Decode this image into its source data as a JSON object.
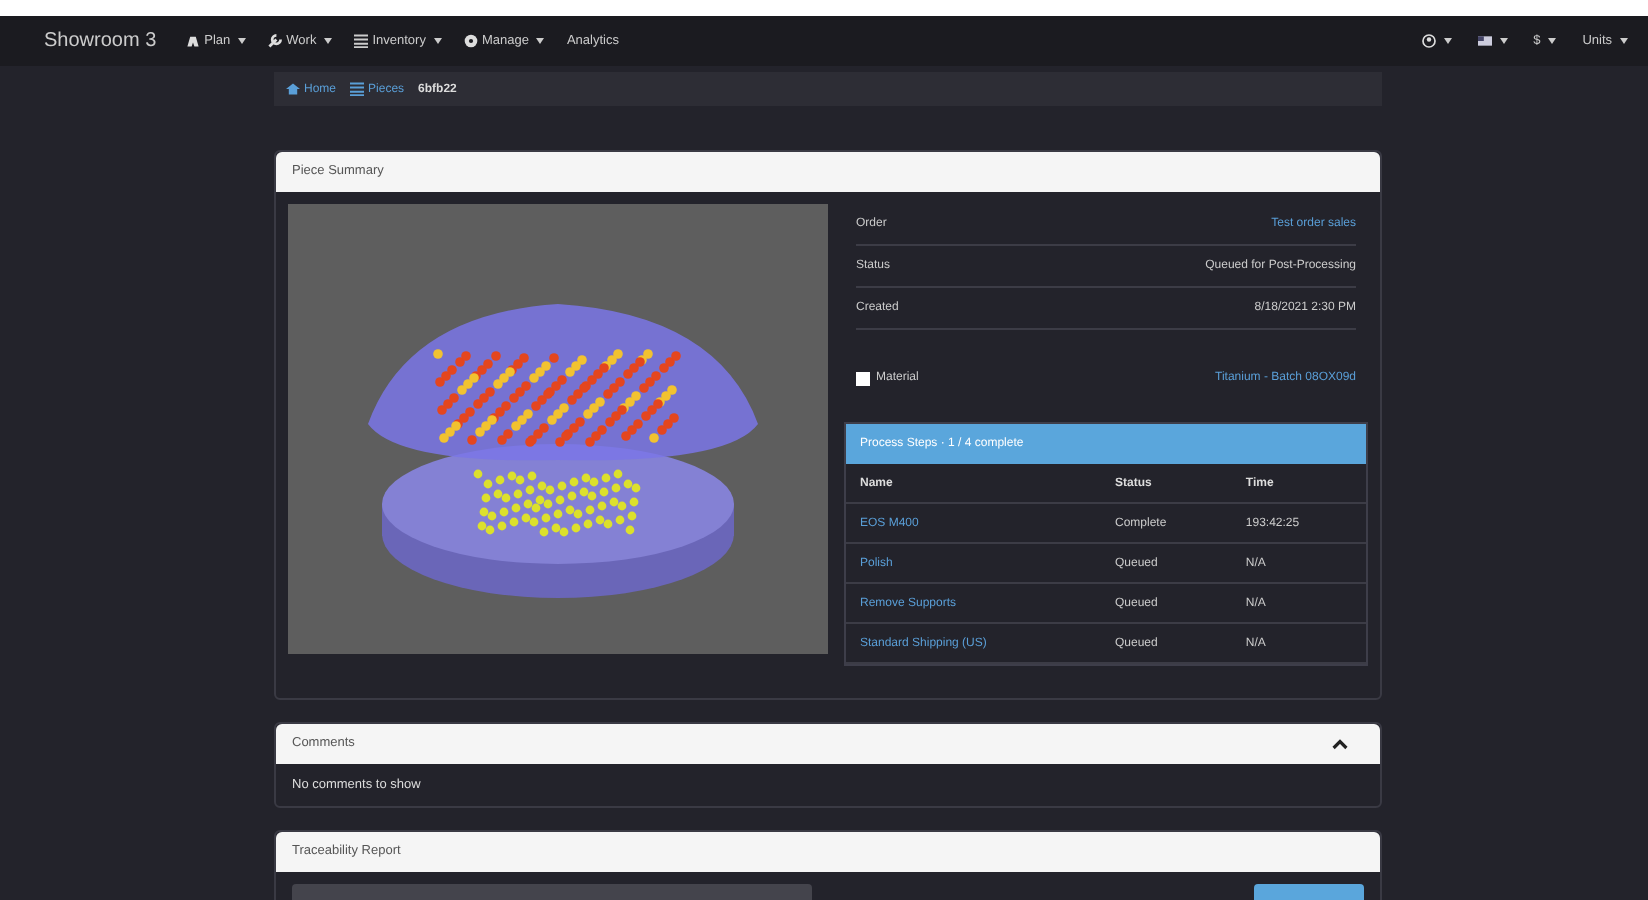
{
  "navbar": {
    "brand": "Showroom 3",
    "menus": [
      {
        "label": "Plan",
        "dropdown": true
      },
      {
        "label": "Work",
        "dropdown": true
      },
      {
        "label": "Inventory",
        "dropdown": true
      },
      {
        "label": "Manage",
        "dropdown": true
      },
      {
        "label": "Analytics",
        "dropdown": false
      }
    ],
    "right_menus": [
      {
        "dropdown": true
      },
      {
        "dropdown": true
      },
      {
        "label": "$",
        "dropdown": true
      },
      {
        "label": "Units",
        "dropdown": true
      }
    ]
  },
  "breadcrumb": [
    {
      "label": "Home",
      "link": true
    },
    {
      "label": "Pieces",
      "link": true
    },
    {
      "label": "6bfb22",
      "link": false
    }
  ],
  "piece_summary": {
    "title": "Piece Summary",
    "details": [
      {
        "label": "Order",
        "value": "Test order sales",
        "link": true
      },
      {
        "label": "Status",
        "value": "Queued for Post-Processing",
        "link": false
      },
      {
        "label": "Created",
        "value": "8/18/2021 2:30 PM",
        "link": false
      },
      {
        "label": "Material",
        "value": "Titanium - Batch 08OX09d",
        "link": true
      }
    ],
    "process_steps": {
      "title": "Process Steps · 1 / 4 complete",
      "columns": [
        "Name",
        "Status",
        "Time"
      ],
      "rows": [
        [
          "EOS M400",
          "Complete",
          "193:42:25"
        ],
        [
          "Polish",
          "Queued",
          "N/A"
        ],
        [
          "Remove Supports",
          "Queued",
          "N/A"
        ],
        [
          "Standard Shipping (US)",
          "Queued",
          "N/A"
        ]
      ]
    }
  },
  "comments": {
    "title": "Comments",
    "expanded": true,
    "body": "No comments to show"
  },
  "traceability": {
    "title": "Traceability Report"
  }
}
